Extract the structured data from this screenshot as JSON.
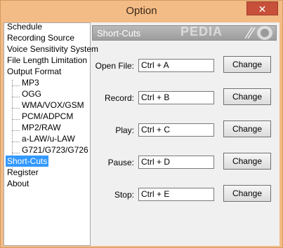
{
  "window": {
    "title": "Option",
    "close_icon": "close-icon"
  },
  "tree": {
    "items": [
      {
        "label": "Schedule"
      },
      {
        "label": "Recording Source"
      },
      {
        "label": "Voice Sensitivity System"
      },
      {
        "label": "File Length Limitation"
      },
      {
        "label": "Output Format"
      },
      {
        "label": "MP3"
      },
      {
        "label": "OGG"
      },
      {
        "label": "WMA/VOX/GSM"
      },
      {
        "label": "PCM/ADPCM"
      },
      {
        "label": "MP2/RAW"
      },
      {
        "label": "a-LAW/u-LAW"
      },
      {
        "label": "G721/G723/G726"
      },
      {
        "label": "Short-Cuts"
      },
      {
        "label": "Register"
      },
      {
        "label": "About"
      }
    ],
    "selected": "Short-Cuts"
  },
  "panel": {
    "title": "Short-Cuts",
    "watermark": "PEDIA",
    "fields": [
      {
        "label": "Open File:",
        "value": "Ctrl + A",
        "button": "Change"
      },
      {
        "label": "Record:",
        "value": "Ctrl + B",
        "button": "Change"
      },
      {
        "label": "Play:",
        "value": "Ctrl + C",
        "button": "Change"
      },
      {
        "label": "Pause:",
        "value": "Ctrl + D",
        "button": "Change"
      },
      {
        "label": "Stop:",
        "value": "Ctrl + E",
        "button": "Change"
      }
    ]
  },
  "colors": {
    "titlebar": "#f3bb85",
    "close": "#c7503b",
    "selection": "#3399ff"
  }
}
